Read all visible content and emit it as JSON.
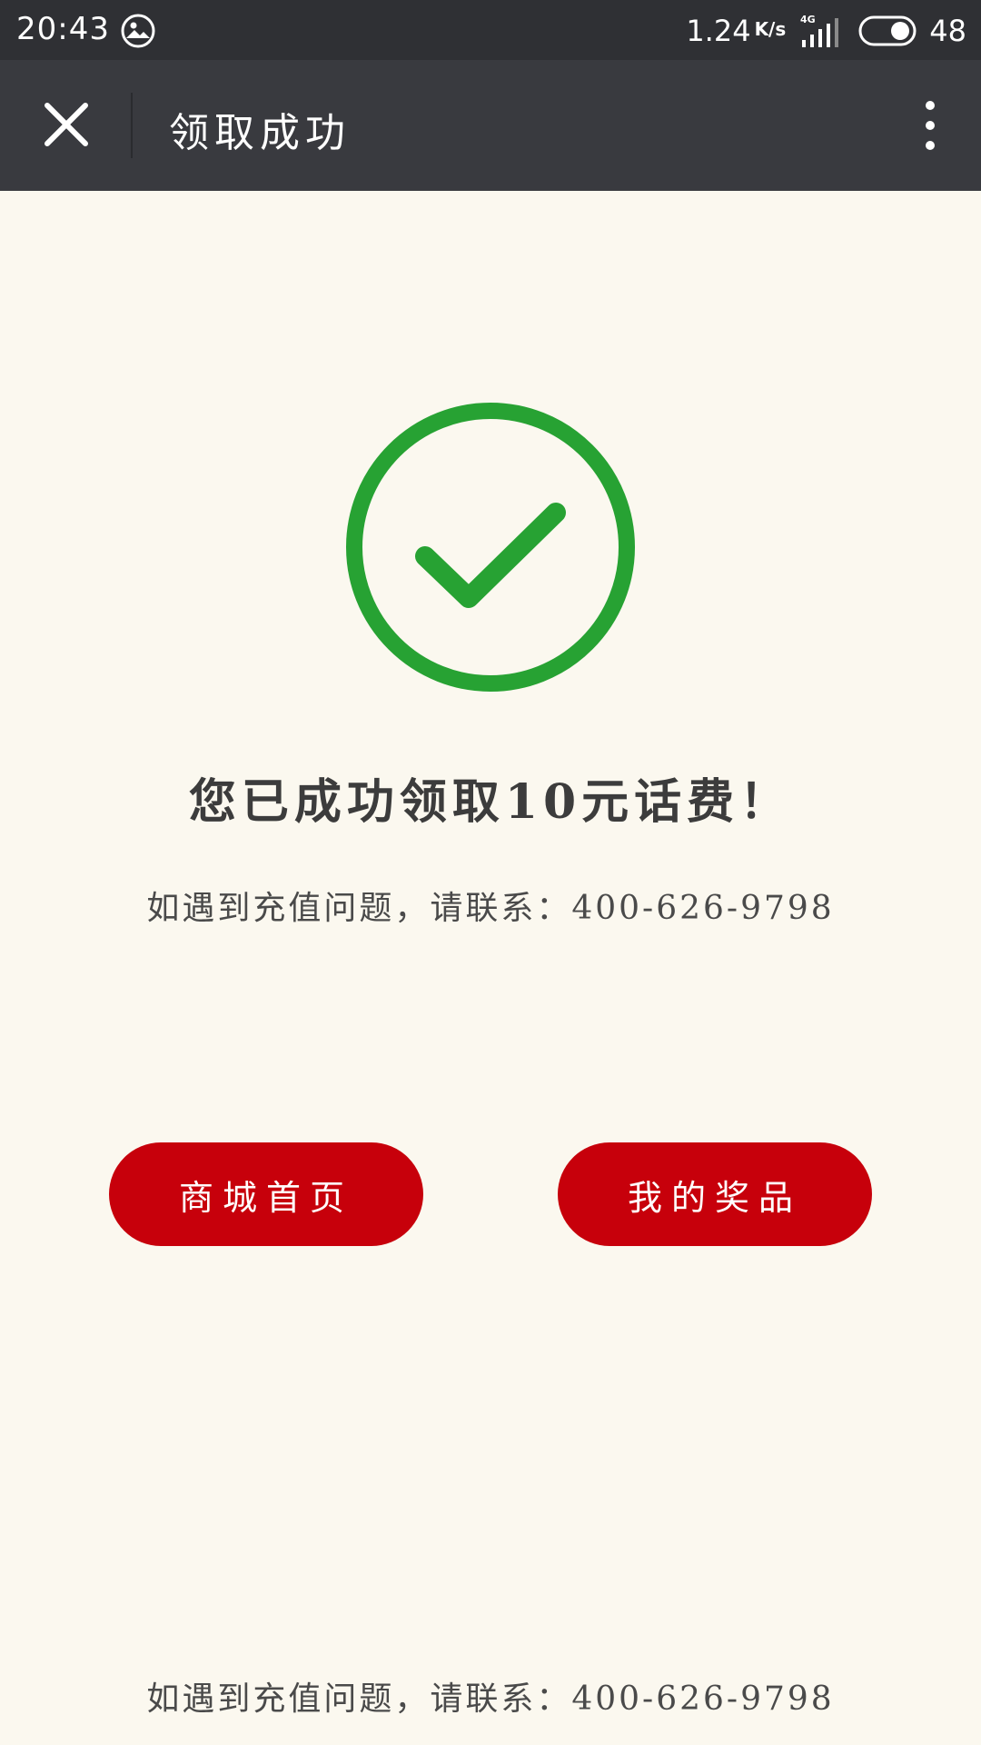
{
  "status_bar": {
    "time": "20:43",
    "net_speed": "1.24",
    "net_unit": "K/s",
    "network_type": "4G",
    "battery": "48"
  },
  "title_bar": {
    "title": "领取成功"
  },
  "main": {
    "success_message": "您已成功领取10元话费！",
    "contact_text": "如遇到充值问题，请联系：400-626-9798",
    "buttons": {
      "home_label": "商城首页",
      "prizes_label": "我的奖品"
    },
    "footer_contact_text": "如遇到充值问题，请联系：400-626-9798"
  },
  "colors": {
    "status_bar_bg": "#2f3034",
    "title_bar_bg": "#393a3f",
    "page_bg": "#fbf8ef",
    "success_green": "#27a233",
    "button_red": "#c7000b"
  },
  "icons": [
    "photo-icon",
    "signal-icon",
    "toggle-icon",
    "close-icon",
    "more-icon",
    "success-check-icon"
  ]
}
